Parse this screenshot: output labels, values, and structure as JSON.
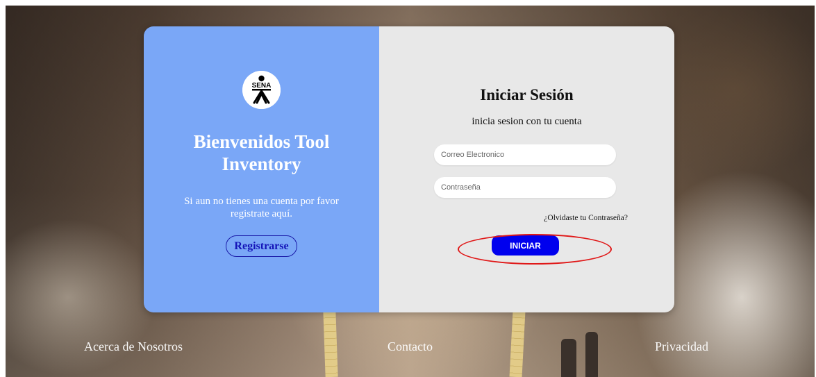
{
  "welcome_panel": {
    "logo_text": "SENA",
    "heading": "Bienvenidos Tool Inventory",
    "register_prompt": "Si aun no tienes una cuenta por favor registrate aquí.",
    "register_button": "Registrarse",
    "background_color": "#7aa7f7"
  },
  "login_panel": {
    "title": "Iniciar Sesión",
    "subtitle": "inicia sesion con tu cuenta",
    "email_placeholder": "Correo Electronico",
    "email_value": "",
    "password_placeholder": "Contraseña",
    "password_value": "",
    "forgot_password": "¿Olvidaste tu Contraseña?",
    "submit_button": "INICIAR",
    "submit_color": "#0000ee"
  },
  "annotation": {
    "highlight_color": "#e01818"
  },
  "footer": {
    "links": [
      "Acerca de Nosotros",
      "Contacto",
      "Privacidad"
    ]
  }
}
